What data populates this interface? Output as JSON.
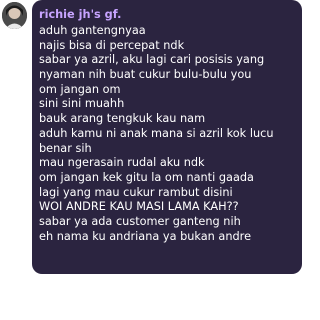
{
  "message": {
    "sender_name": "richie jh's gf.",
    "sender_color": "#c7a4ff",
    "bubble_color": "#2b2440",
    "lines": [
      "aduh gantengnyaa",
      "najis bisa di percepat ndk",
      "sabar ya azril, aku lagi cari posisis yang",
      "nyaman nih buat cukur bulu-bulu you",
      "om jangan om",
      "sini sini muahh",
      "bauk arang tengkuk kau nam",
      "aduh kamu ni anak mana si azril kok lucu",
      "benar sih",
      "mau ngerasain rudal aku ndk",
      "om jangan kek gitu la om nanti gaada",
      "lagi yang mau cukur rambut disini",
      "WOI ANDRE KAU MASI LAMA KAH??",
      "sabar ya ada customer ganteng nih",
      "eh nama ku andriana ya bukan andre"
    ]
  },
  "avatar_icon": "profile-avatar"
}
